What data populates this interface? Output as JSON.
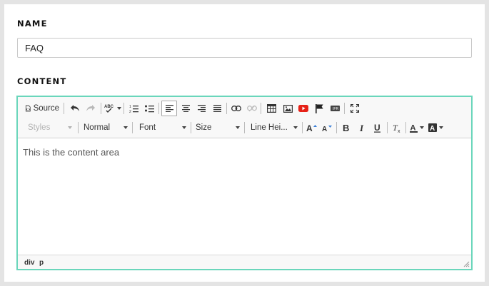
{
  "form": {
    "name_label": "NAME",
    "name_value": "FAQ",
    "content_label": "CONTENT"
  },
  "editor": {
    "toolbar": {
      "source_label": "Source",
      "styles_label": "Styles",
      "format_label": "Normal",
      "font_label": "Font",
      "size_label": "Size",
      "line_height_label": "Line Hei...",
      "icons": [
        "source-icon",
        "undo-icon",
        "redo-icon",
        "spellcheck-icon",
        "numbered-list-icon",
        "bulleted-list-icon",
        "align-left-icon",
        "align-center-icon",
        "align-right-icon",
        "justify-icon",
        "link-icon",
        "unlink-icon",
        "table-icon",
        "image-icon",
        "youtube-icon",
        "flag-icon",
        "iframe-icon",
        "maximize-icon",
        "increase-font-icon",
        "decrease-font-icon",
        "bold-icon",
        "italic-icon",
        "underline-icon",
        "remove-format-icon",
        "text-color-icon",
        "background-color-icon"
      ]
    },
    "content_text": "This is the content area",
    "status_path": [
      "div",
      "p"
    ]
  },
  "colors": {
    "editor_border": "#6ad6bb",
    "youtube_red": "#e62117",
    "page_background": "#e4e4e4"
  }
}
